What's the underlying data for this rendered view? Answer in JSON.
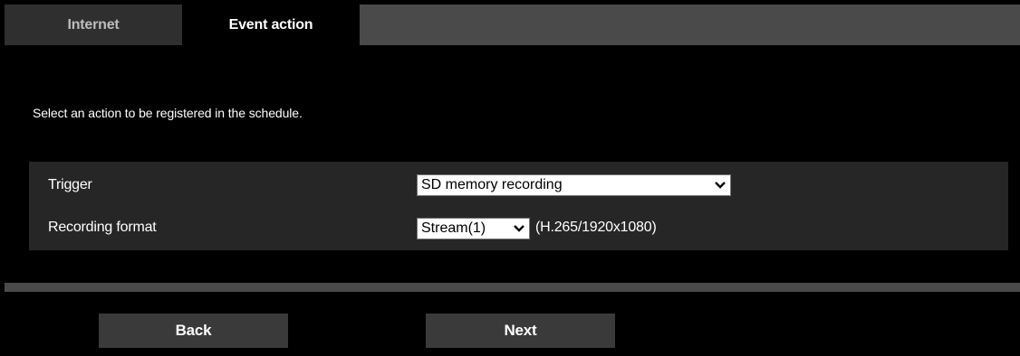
{
  "tabs": [
    {
      "label": "Internet",
      "active": false
    },
    {
      "label": "Event action",
      "active": true
    }
  ],
  "instruction": "Select an action to be registered in the schedule.",
  "form": {
    "trigger": {
      "label": "Trigger",
      "selected": "SD memory recording"
    },
    "recording_format": {
      "label": "Recording format",
      "selected": "Stream(1)",
      "detail": "(H.265/1920x1080)"
    }
  },
  "buttons": {
    "back": "Back",
    "next": "Next"
  },
  "colors": {
    "background": "#000000",
    "tabbar": "#4a4a4a",
    "panel": "#262626",
    "button": "#3a3a3a"
  },
  "icons": {
    "dropdown": "chevron-down-icon"
  }
}
